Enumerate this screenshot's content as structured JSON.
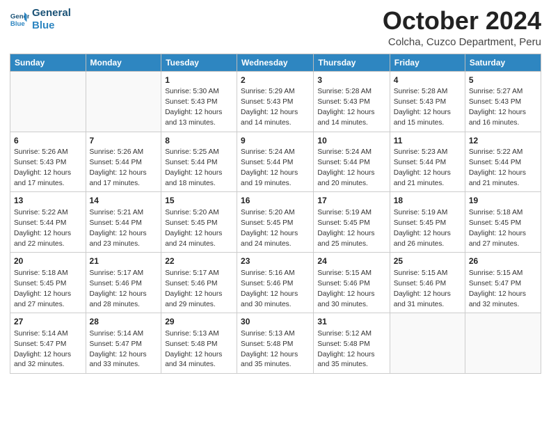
{
  "header": {
    "logo_line1": "General",
    "logo_line2": "Blue",
    "month": "October 2024",
    "location": "Colcha, Cuzco Department, Peru"
  },
  "weekdays": [
    "Sunday",
    "Monday",
    "Tuesday",
    "Wednesday",
    "Thursday",
    "Friday",
    "Saturday"
  ],
  "weeks": [
    [
      {
        "day": "",
        "info": ""
      },
      {
        "day": "",
        "info": ""
      },
      {
        "day": "1",
        "info": "Sunrise: 5:30 AM\nSunset: 5:43 PM\nDaylight: 12 hours\nand 13 minutes."
      },
      {
        "day": "2",
        "info": "Sunrise: 5:29 AM\nSunset: 5:43 PM\nDaylight: 12 hours\nand 14 minutes."
      },
      {
        "day": "3",
        "info": "Sunrise: 5:28 AM\nSunset: 5:43 PM\nDaylight: 12 hours\nand 14 minutes."
      },
      {
        "day": "4",
        "info": "Sunrise: 5:28 AM\nSunset: 5:43 PM\nDaylight: 12 hours\nand 15 minutes."
      },
      {
        "day": "5",
        "info": "Sunrise: 5:27 AM\nSunset: 5:43 PM\nDaylight: 12 hours\nand 16 minutes."
      }
    ],
    [
      {
        "day": "6",
        "info": "Sunrise: 5:26 AM\nSunset: 5:43 PM\nDaylight: 12 hours\nand 17 minutes."
      },
      {
        "day": "7",
        "info": "Sunrise: 5:26 AM\nSunset: 5:44 PM\nDaylight: 12 hours\nand 17 minutes."
      },
      {
        "day": "8",
        "info": "Sunrise: 5:25 AM\nSunset: 5:44 PM\nDaylight: 12 hours\nand 18 minutes."
      },
      {
        "day": "9",
        "info": "Sunrise: 5:24 AM\nSunset: 5:44 PM\nDaylight: 12 hours\nand 19 minutes."
      },
      {
        "day": "10",
        "info": "Sunrise: 5:24 AM\nSunset: 5:44 PM\nDaylight: 12 hours\nand 20 minutes."
      },
      {
        "day": "11",
        "info": "Sunrise: 5:23 AM\nSunset: 5:44 PM\nDaylight: 12 hours\nand 21 minutes."
      },
      {
        "day": "12",
        "info": "Sunrise: 5:22 AM\nSunset: 5:44 PM\nDaylight: 12 hours\nand 21 minutes."
      }
    ],
    [
      {
        "day": "13",
        "info": "Sunrise: 5:22 AM\nSunset: 5:44 PM\nDaylight: 12 hours\nand 22 minutes."
      },
      {
        "day": "14",
        "info": "Sunrise: 5:21 AM\nSunset: 5:44 PM\nDaylight: 12 hours\nand 23 minutes."
      },
      {
        "day": "15",
        "info": "Sunrise: 5:20 AM\nSunset: 5:45 PM\nDaylight: 12 hours\nand 24 minutes."
      },
      {
        "day": "16",
        "info": "Sunrise: 5:20 AM\nSunset: 5:45 PM\nDaylight: 12 hours\nand 24 minutes."
      },
      {
        "day": "17",
        "info": "Sunrise: 5:19 AM\nSunset: 5:45 PM\nDaylight: 12 hours\nand 25 minutes."
      },
      {
        "day": "18",
        "info": "Sunrise: 5:19 AM\nSunset: 5:45 PM\nDaylight: 12 hours\nand 26 minutes."
      },
      {
        "day": "19",
        "info": "Sunrise: 5:18 AM\nSunset: 5:45 PM\nDaylight: 12 hours\nand 27 minutes."
      }
    ],
    [
      {
        "day": "20",
        "info": "Sunrise: 5:18 AM\nSunset: 5:45 PM\nDaylight: 12 hours\nand 27 minutes."
      },
      {
        "day": "21",
        "info": "Sunrise: 5:17 AM\nSunset: 5:46 PM\nDaylight: 12 hours\nand 28 minutes."
      },
      {
        "day": "22",
        "info": "Sunrise: 5:17 AM\nSunset: 5:46 PM\nDaylight: 12 hours\nand 29 minutes."
      },
      {
        "day": "23",
        "info": "Sunrise: 5:16 AM\nSunset: 5:46 PM\nDaylight: 12 hours\nand 30 minutes."
      },
      {
        "day": "24",
        "info": "Sunrise: 5:15 AM\nSunset: 5:46 PM\nDaylight: 12 hours\nand 30 minutes."
      },
      {
        "day": "25",
        "info": "Sunrise: 5:15 AM\nSunset: 5:46 PM\nDaylight: 12 hours\nand 31 minutes."
      },
      {
        "day": "26",
        "info": "Sunrise: 5:15 AM\nSunset: 5:47 PM\nDaylight: 12 hours\nand 32 minutes."
      }
    ],
    [
      {
        "day": "27",
        "info": "Sunrise: 5:14 AM\nSunset: 5:47 PM\nDaylight: 12 hours\nand 32 minutes."
      },
      {
        "day": "28",
        "info": "Sunrise: 5:14 AM\nSunset: 5:47 PM\nDaylight: 12 hours\nand 33 minutes."
      },
      {
        "day": "29",
        "info": "Sunrise: 5:13 AM\nSunset: 5:48 PM\nDaylight: 12 hours\nand 34 minutes."
      },
      {
        "day": "30",
        "info": "Sunrise: 5:13 AM\nSunset: 5:48 PM\nDaylight: 12 hours\nand 35 minutes."
      },
      {
        "day": "31",
        "info": "Sunrise: 5:12 AM\nSunset: 5:48 PM\nDaylight: 12 hours\nand 35 minutes."
      },
      {
        "day": "",
        "info": ""
      },
      {
        "day": "",
        "info": ""
      }
    ]
  ]
}
